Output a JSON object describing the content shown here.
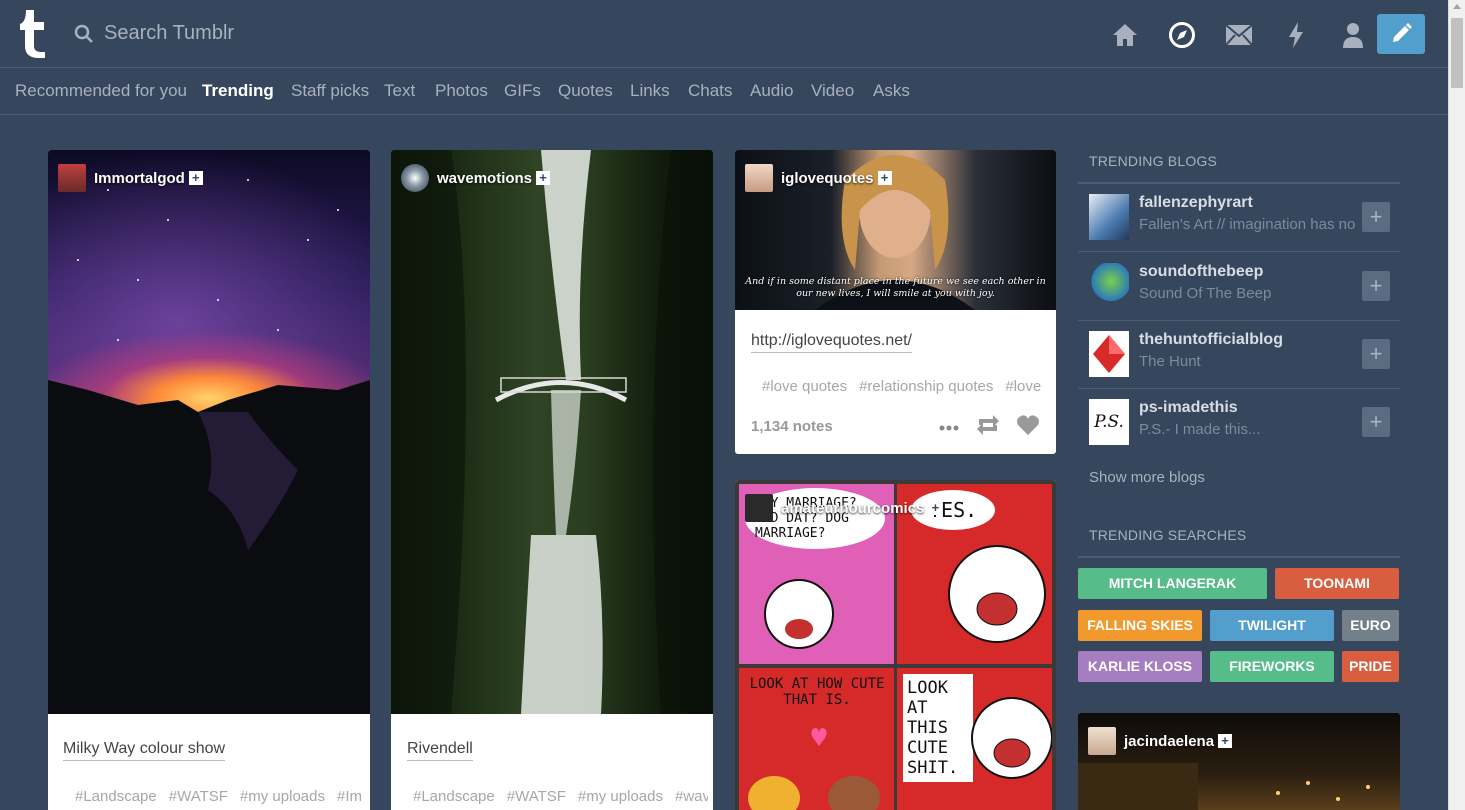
{
  "header": {
    "search_placeholder": "Search Tumblr",
    "icons": [
      "home-icon",
      "explore-icon",
      "inbox-icon",
      "activity-icon",
      "account-icon",
      "compose-icon"
    ]
  },
  "tabs": [
    {
      "label": "Recommended for you"
    },
    {
      "label": "Trending",
      "active": true
    },
    {
      "label": "Staff picks"
    },
    {
      "label": "Text"
    },
    {
      "label": "Photos"
    },
    {
      "label": "GIFs"
    },
    {
      "label": "Quotes"
    },
    {
      "label": "Links"
    },
    {
      "label": "Chats"
    },
    {
      "label": "Audio"
    },
    {
      "label": "Video"
    },
    {
      "label": "Asks"
    }
  ],
  "posts": [
    {
      "blog": "Immortalgod",
      "caption": "Milky Way colour show",
      "tags": [
        "#Landscape",
        "#WATSF",
        "#my uploads",
        "#Im"
      ]
    },
    {
      "blog": "wavemotions",
      "caption": "Rivendell",
      "tags": [
        "#Landscape",
        "#WATSF",
        "#my uploads",
        "#waver"
      ]
    },
    {
      "blog": "iglovequotes",
      "image_caption": "And if in some distant place in the future we see each other in our new lives, I will smile at you with joy.",
      "link": "http://iglovequotes.net/",
      "tags": [
        "#love quotes",
        "#relationship quotes",
        "#love"
      ],
      "notes": "1,134 notes"
    },
    {
      "blog": "amateurhourcomics",
      "panels": [
        "SAY MARRIAGE? AND DAT? DOG MARRIAGE?",
        "YES.",
        "LOOK AT HOW CUTE THAT IS.",
        "LOOK AT THIS CUTE SHIT."
      ]
    }
  ],
  "sidebar": {
    "trending_blogs_title": "TRENDING BLOGS",
    "blogs": [
      {
        "name": "fallenzephyrart",
        "desc": "Fallen's Art // imagination has no"
      },
      {
        "name": "soundofthebeep",
        "desc": "Sound Of The Beep"
      },
      {
        "name": "thehuntofficialblog",
        "desc": "The Hunt"
      },
      {
        "name": "ps-imadethis",
        "desc": "P.S.- I made this...",
        "avatar_text": "P.S."
      }
    ],
    "show_more": "Show more blogs",
    "trending_searches_title": "TRENDING SEARCHES",
    "searches": [
      {
        "label": "MITCH LANGERAK",
        "color": "#56bc8a"
      },
      {
        "label": "TOONAMI",
        "color": "#d95e40"
      },
      {
        "label": "FALLING SKIES",
        "color": "#f2992e"
      },
      {
        "label": "TWILIGHT",
        "color": "#529ecc"
      },
      {
        "label": "EURO",
        "color": "#748089"
      },
      {
        "label": "KARLIE KLOSS",
        "color": "#a77dc2"
      },
      {
        "label": "FIREWORKS",
        "color": "#56bc8a"
      },
      {
        "label": "PRIDE",
        "color": "#d95e40"
      }
    ],
    "radar_blog": "jacindaelena"
  }
}
